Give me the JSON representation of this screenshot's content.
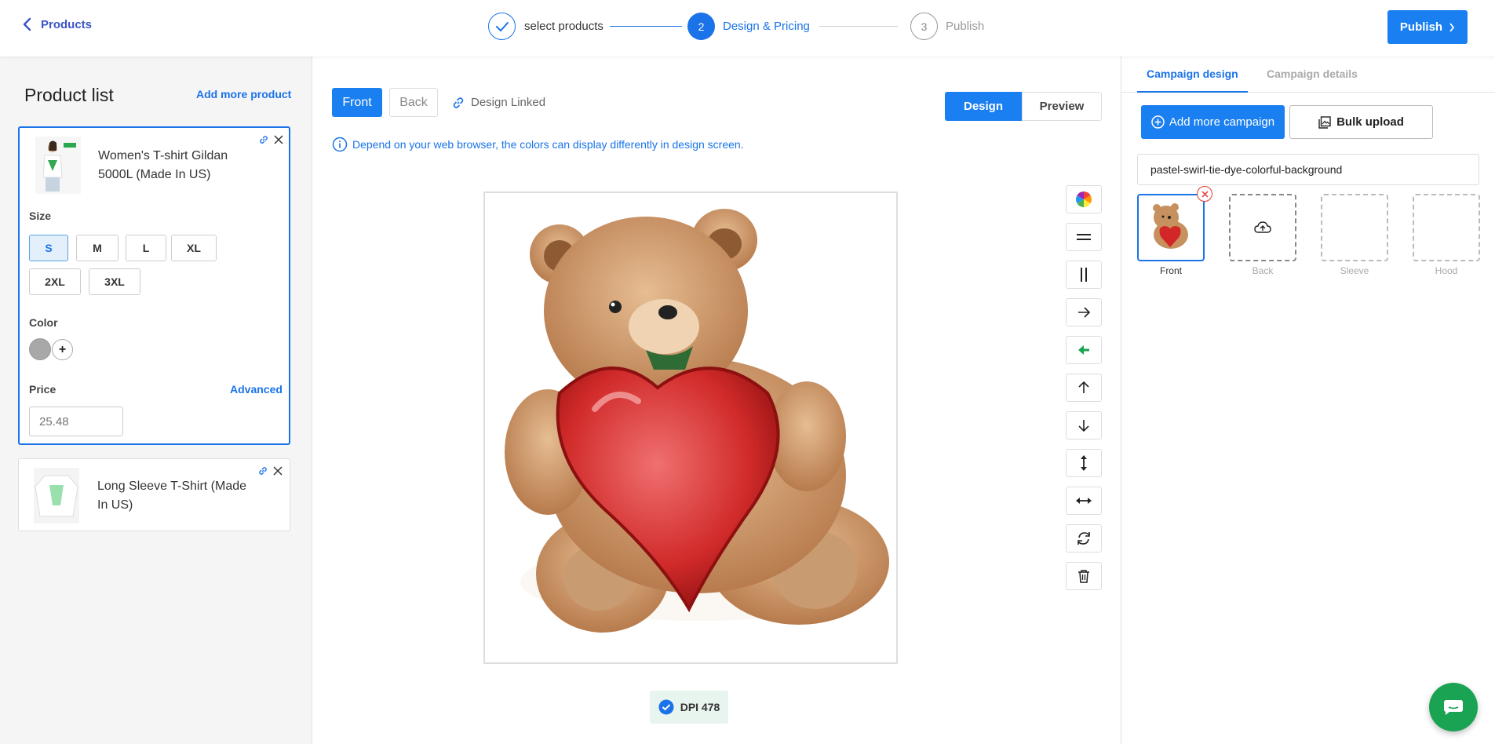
{
  "header": {
    "back_label": "Products",
    "steps": [
      {
        "number": "1",
        "label": "select products",
        "state": "done"
      },
      {
        "number": "2",
        "label": "Design & Pricing",
        "state": "active"
      },
      {
        "number": "3",
        "label": "Publish",
        "state": "pending"
      }
    ],
    "publish_label": "Publish"
  },
  "product_list": {
    "title": "Product list",
    "add_more_label": "Add more product",
    "products": [
      {
        "name": "Women's T-shirt Gildan 5000L (Made In US)",
        "size_label": "Size",
        "sizes": [
          "S",
          "M",
          "L",
          "XL",
          "2XL",
          "3XL"
        ],
        "selected_size": "S",
        "color_label": "Color",
        "colors": [
          "#a8a8a8"
        ],
        "price_label": "Price",
        "advanced_label": "Advanced",
        "price_placeholder": "25.48"
      },
      {
        "name": "Long Sleeve T-Shirt (Made In US)"
      }
    ]
  },
  "design": {
    "side_tabs": [
      "Front",
      "Back"
    ],
    "active_side": "Front",
    "linked_label": "Design Linked",
    "mode_tabs": [
      "Design",
      "Preview"
    ],
    "active_mode": "Design",
    "info_text": "Depend on your web browser, the colors can display differently in design screen.",
    "dpi_label": "DPI 478",
    "tools": [
      "color-wheel-icon",
      "align-horizontal-center-icon",
      "align-vertical-center-icon",
      "arrow-right-icon",
      "arrow-left-icon",
      "arrow-up-icon",
      "arrow-down-icon",
      "stretch-vertical-icon",
      "stretch-horizontal-icon",
      "rotate-icon",
      "trash-icon"
    ],
    "accent_color": "#1a7ff0",
    "active_tool_color": "#1aa352"
  },
  "campaign": {
    "tabs": [
      "Campaign design",
      "Campaign details"
    ],
    "active_tab": "Campaign design",
    "add_more_label": "Add more campaign",
    "bulk_upload_label": "Bulk upload",
    "file_name": "pastel-swirl-tie-dye-colorful-background",
    "slots": [
      "Front",
      "Back",
      "Sleeve",
      "Hood"
    ]
  }
}
